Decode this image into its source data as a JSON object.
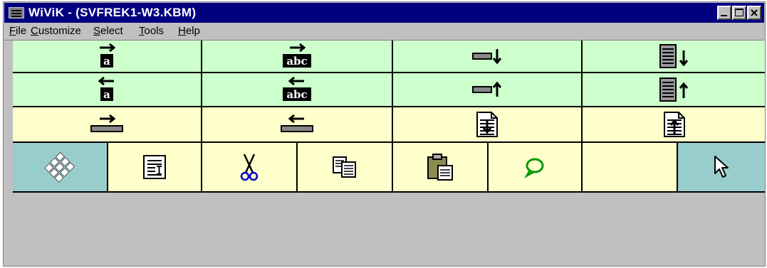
{
  "window": {
    "title": "WiViK -  (SVFREK1-W3.KBM)",
    "controls": [
      "minimize-icon",
      "maximize-icon",
      "close-icon"
    ]
  },
  "menu": [
    {
      "mnemonic": "F",
      "rest": "ile"
    },
    {
      "mnemonic": "C",
      "rest": "ustomize"
    },
    {
      "mnemonic": "S",
      "rest": "elect"
    },
    {
      "mnemonic": "T",
      "rest": "ools"
    },
    {
      "mnemonic": "H",
      "rest": "elp"
    }
  ],
  "keys": {
    "row1": [
      {
        "name": "move-right-char-icon",
        "glyph": "a"
      },
      {
        "name": "move-right-word-icon",
        "glyph": "abc"
      },
      {
        "name": "move-down-line-icon"
      },
      {
        "name": "move-down-page-icon"
      }
    ],
    "row2": [
      {
        "name": "move-left-char-icon",
        "glyph": "a"
      },
      {
        "name": "move-left-word-icon",
        "glyph": "abc"
      },
      {
        "name": "move-up-line-icon"
      },
      {
        "name": "move-up-page-icon"
      }
    ],
    "row3": [
      {
        "name": "line-end-icon"
      },
      {
        "name": "line-start-icon"
      },
      {
        "name": "document-end-icon"
      },
      {
        "name": "document-start-icon"
      }
    ],
    "row4": [
      {
        "name": "keyboard-icon"
      },
      {
        "name": "text-cursor-document-icon"
      },
      {
        "name": "cut-icon"
      },
      {
        "name": "copy-icon"
      },
      {
        "name": "paste-icon"
      },
      {
        "name": "speech-bubble-icon"
      },
      {
        "name": "empty-key"
      },
      {
        "name": "pointer-arrow-icon"
      }
    ]
  },
  "colors": {
    "title_bar": "#000080",
    "nav_row_bg": "#ccffcc",
    "edit_row_bg": "#ffffcc",
    "special_key_bg": "#99cccc",
    "speech_icon": "#009900"
  }
}
